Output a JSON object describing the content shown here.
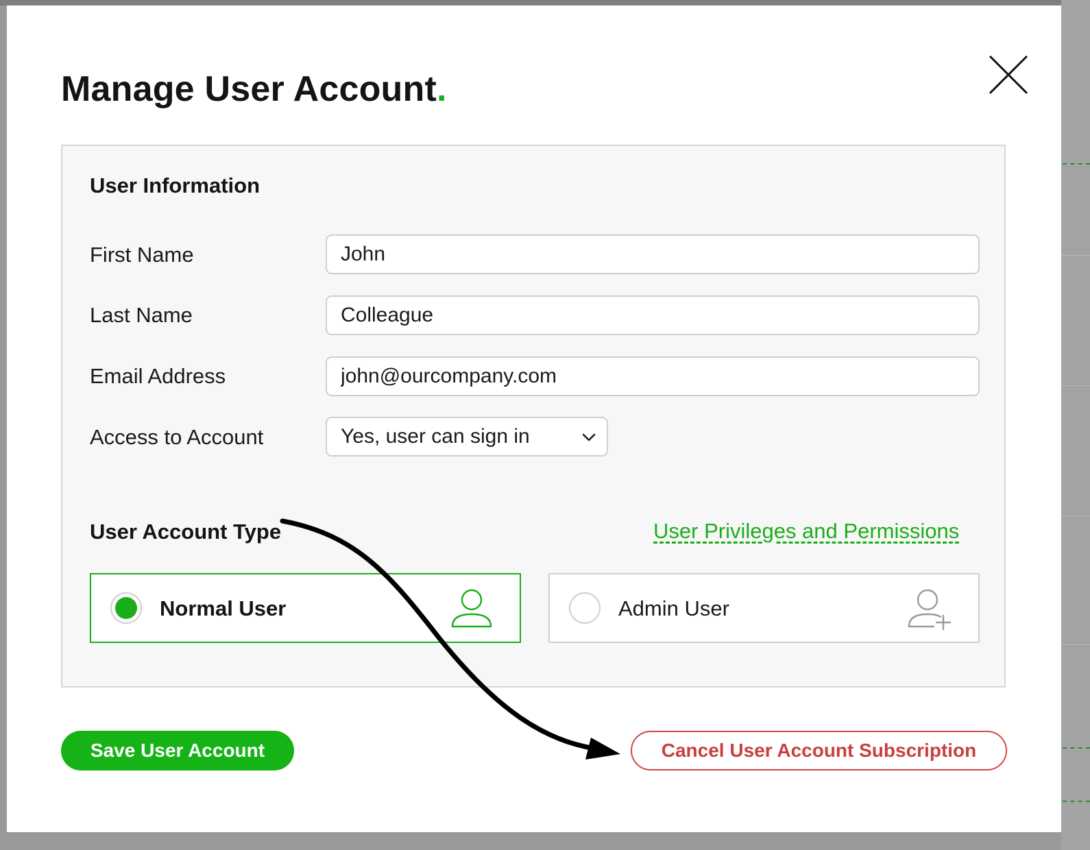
{
  "dialog": {
    "title": "Manage User Account",
    "title_dot": ".",
    "accent_color": "#1aae1a",
    "close_icon": "close-icon"
  },
  "user_information": {
    "heading": "User Information",
    "fields": {
      "first_name": {
        "label": "First Name",
        "value": "John"
      },
      "last_name": {
        "label": "Last Name",
        "value": "Colleague"
      },
      "email": {
        "label": "Email Address",
        "value": "john@ourcompany.com"
      },
      "access": {
        "label": "Access to Account",
        "selected": "Yes, user can sign in",
        "icon": "chevron-down-icon"
      }
    }
  },
  "account_type": {
    "heading": "User Account Type",
    "link_label": "User Privileges and Permissions",
    "options": [
      {
        "label": "Normal User",
        "selected": true,
        "icon": "user-icon"
      },
      {
        "label": "Admin User",
        "selected": false,
        "icon": "user-plus-icon"
      }
    ]
  },
  "actions": {
    "save_label": "Save User Account",
    "save_color": "#16b316",
    "cancel_label": "Cancel User Account Subscription",
    "cancel_color": "#c84040"
  },
  "annotation": {
    "icon": "curved-arrow-icon"
  }
}
